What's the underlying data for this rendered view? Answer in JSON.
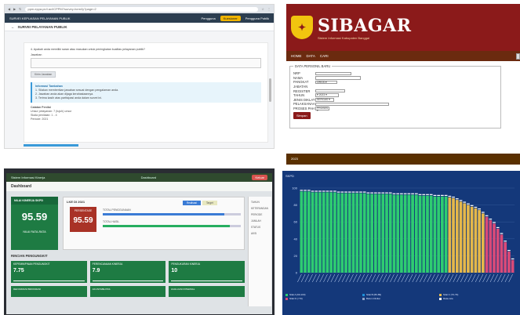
{
  "survey": {
    "url": "ppm.epya.pn/i.ac/ICPPM?survey-form/ly?page=2",
    "app_title": "SURVEI KEPUASAN PELAYANAN PUBLIK",
    "user": "Pengguna",
    "btn_label": "Kuesioner",
    "user_name": "Pengguna Publik",
    "page_title": "SURVEI PELAYANAN PUBLIK",
    "question": "4. Apakah anda memiliki saran atau masukan untuk peningkatan kualitas pelayanan publik?",
    "field_label": "Jawaban",
    "reply_button": "Kirim Jawaban",
    "info_title": "Informasi Tambahan",
    "info_lines": [
      "1. Silakan memberikan jawaban sesuai dengan pengalaman anda.",
      "2. Jawaban anda akan dijaga kerahasiaannya.",
      "3. Terima kasih atas partisipasi anda dalam survei ini."
    ],
    "sub_title": "Catatan Penilai",
    "sub_lines": [
      "Unsur pelayanan: 7 (tujuh) unsur",
      "Skala penilaian: 1 - 4",
      "Periode: 2021"
    ]
  },
  "sibagar": {
    "logo_glyph": "✦",
    "brand": "SIBAGAR",
    "tagline": "Sistem Informasi Kabupaten Banggai",
    "nav": [
      "HOME",
      "DATA",
      "CARI"
    ],
    "legend": "DATA PERSONIL BARU",
    "fields": [
      {
        "label": "NRP",
        "value": "",
        "width": 46
      },
      {
        "label": "NAMA",
        "value": "",
        "width": 58
      },
      {
        "label": "PANGKAT",
        "value": "ORGS ▾",
        "width": 28
      },
      {
        "label": "JABATAN",
        "value": "",
        "width": 0
      },
      {
        "label": "REGISTER",
        "value": "",
        "width": 38
      },
      {
        "label": "TAHUN",
        "value": "▾ 2023 ▾",
        "width": 30
      },
      {
        "label": "JENIS DIKLAT",
        "value": "SERGAS ▾",
        "width": 24
      },
      {
        "label": "PELAKSANAAN",
        "value": "",
        "width": 94
      },
      {
        "label": "PROSES PAH",
        "value": "PROSES ▾",
        "width": 18
      }
    ],
    "submit": "Simpan",
    "footer": "2023"
  },
  "dashboard": {
    "topbar_left": "Sistem Informasi Kinerja",
    "topbar_mid": "Dashboard",
    "topbar_right": "Keluar",
    "title": "Dashboard",
    "card_a_title": "NILAI KINERJA SKPD",
    "card_a_value": "95.59",
    "card_a_caption": "NILAI RATA-RATA",
    "card_b_title": "LKE DI 2021",
    "red_label": "PERSENTASE",
    "red_value": "95.59",
    "toggle_a": "Realisasi",
    "toggle_b": "Target",
    "bar1_label": "TOTAL PENGGUNAAN",
    "bar1_pct": 0.88,
    "bar2_label": "TOTAL HASIL",
    "bar2_pct": 0.92,
    "side_items": [
      "TAHUN",
      "KETERANGAN",
      "PERIODE",
      "JUMLAH",
      "STATUS",
      "AKSI"
    ],
    "section_title": "RINCIAN PENGUNGKIT",
    "minis": [
      {
        "label": "KEPEMIMPINAN PENGUNGKIT",
        "value": "7.75"
      },
      {
        "label": "PERENCANAAN KINERJA",
        "value": "7.9"
      },
      {
        "label": "PENGUKURAN KINERJA",
        "value": "10"
      }
    ],
    "minis_row2": [
      "REFORMASI BIROKRASI",
      "AKUNTABILITAS",
      "EVALUASI INTERNAL"
    ]
  },
  "chart": {
    "title": "SKPD",
    "legend": [
      "Nilai A (90-100)",
      "Nilai B (80-89)",
      "Nilai C (70-79)",
      "Nilai D (<70)",
      "Belum Dinilai",
      "Rata-rata"
    ],
    "colors": {
      "green": "#2ecc71",
      "yellow": "#e5b84a",
      "red": "#d94a78",
      "blue": "#1e8fd8"
    }
  },
  "chart_data": {
    "type": "bar",
    "values": [
      96,
      96,
      96,
      95,
      95,
      95,
      95,
      95,
      95,
      95,
      94,
      94,
      94,
      94,
      94,
      94,
      94,
      94,
      93,
      93,
      93,
      93,
      93,
      93,
      93,
      92,
      92,
      92,
      92,
      92,
      92,
      92,
      91,
      91,
      91,
      91,
      90,
      90,
      90,
      90,
      89,
      88,
      86,
      84,
      82,
      80,
      78,
      76,
      74,
      70,
      66,
      62,
      58,
      52,
      45,
      36,
      25,
      15
    ],
    "ylim": [
      0,
      100
    ]
  }
}
